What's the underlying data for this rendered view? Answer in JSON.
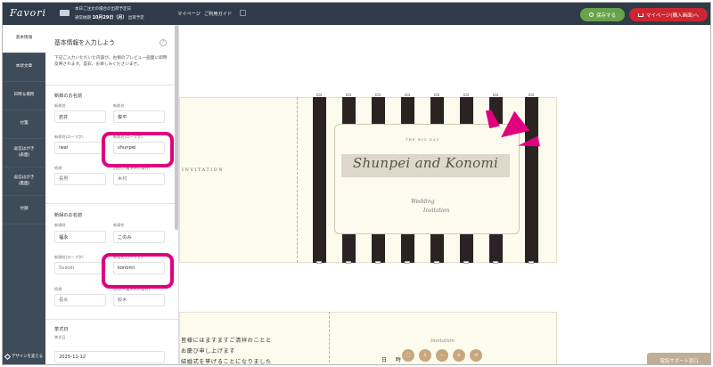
{
  "topbar": {
    "logo": "Favori",
    "shipping_line1": "本日ご注文の場合の出荷予定日",
    "shipping_prefix": "通常納期",
    "shipping_date": "10月29日（月）",
    "shipping_suffix": "出荷予定",
    "mypage_link": "マイページ",
    "guide_link": "ご利用ガイド",
    "save_button": "保存する",
    "mypage_button": "マイページ(購入画面)へ"
  },
  "sidebar": {
    "items": [
      {
        "label": "基本情報"
      },
      {
        "label": "本状文章"
      },
      {
        "label": "日時＆場所"
      },
      {
        "label": "付箋"
      },
      {
        "label": "返信はがき\n(表面)"
      },
      {
        "label": "返信はがき\n(裏面)"
      },
      {
        "label": "付録"
      }
    ],
    "design_change": "デザインを変える"
  },
  "form": {
    "title": "基本情報を入力しよう",
    "help": "?",
    "description": "下記ご入力いただいた内容が、右側のプレビュー画面に即時反映されます。是非、お楽しみくださいませ。",
    "groom_section": "新郎のお名前",
    "groom": {
      "last_name_label": "新郎姓",
      "last_name": "岩井",
      "first_name_label": "新郎名",
      "first_name": "俊平",
      "last_roman_label": "新郎姓(ローマ字)",
      "last_roman": "iwai",
      "first_roman_label": "新郎名(ローマ字)",
      "first_roman": "shunpei",
      "order_label": "続柄",
      "order_placeholder": "長男",
      "oldname_label": "旧姓(入籍済みの場合)",
      "oldname_placeholder": "木村"
    },
    "bride_section": "新婦のお名前",
    "bride": {
      "last_name_label": "新婦姓",
      "last_name": "福永",
      "first_name_label": "新婦名",
      "first_name": "このみ",
      "last_roman_label": "新婦姓(ローマ字)",
      "last_roman_placeholder": "Suzuki",
      "first_roman_label": "新婦名(ローマ字)",
      "first_roman": "konomi",
      "order_label": "続柄",
      "order_placeholder": "長女",
      "oldname_label": "旧姓(入籍済みの場合)",
      "oldname_placeholder": "鈴木"
    },
    "ceremony_section": "挙式日",
    "ceremony_label": "挙式日",
    "ceremony_date": "2025-11-12"
  },
  "preview": {
    "invitation_side": "INVITATION",
    "big_day": "THE BIG DAY",
    "names": "Shunpei and Konomi",
    "script_line1": "Wedding",
    "script_line2": "Invitation",
    "body_line1": "皆様にはますますご清祥のことと",
    "body_line2": "お慶び申し上げます",
    "body_line3": "結婚式を挙げることになりました",
    "invitation_script": "Invitation",
    "day_text": "日 時"
  },
  "tools": [
    "⛶",
    "⇩",
    "−",
    "+",
    "↺"
  ],
  "support_button": "電話サポート窓口",
  "colors": {
    "highlight": "#e0007e",
    "save": "#68a24a",
    "mypage": "#cc2630",
    "sidebar": "#3e4b59",
    "topbar": "#2f3b49"
  }
}
